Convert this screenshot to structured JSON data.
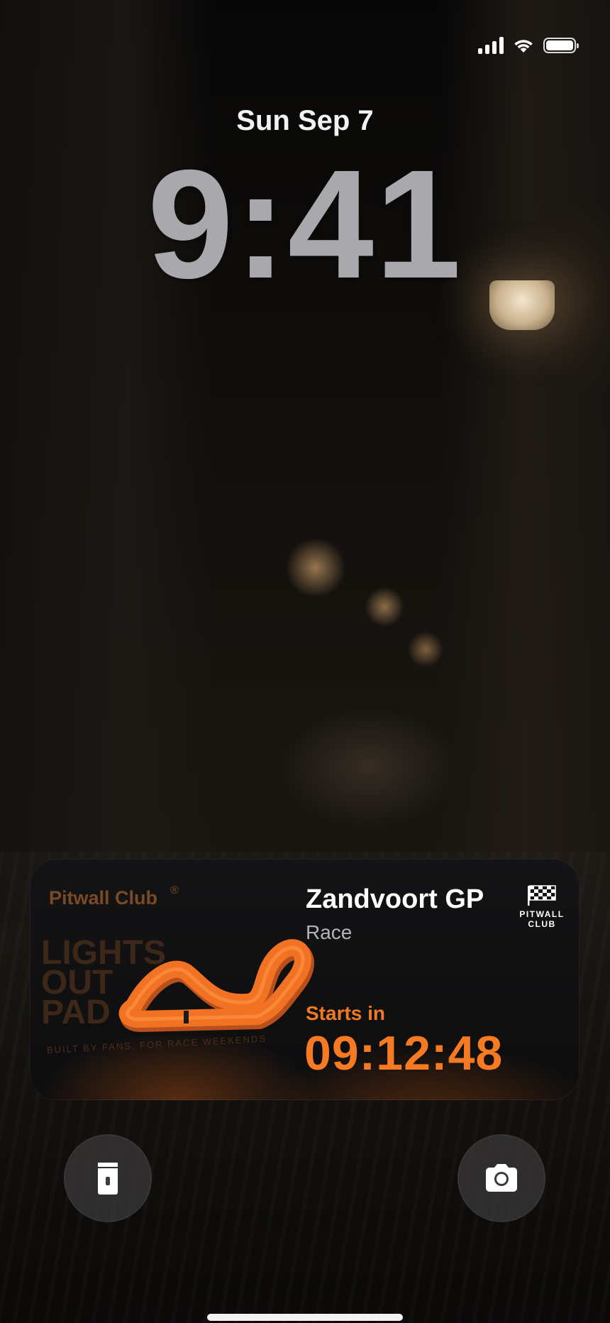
{
  "status_bar": {
    "signal_icon": "cellular-signal-icon",
    "wifi_icon": "wifi-icon",
    "battery_icon": "battery-full-icon",
    "battery_level": 1.0
  },
  "lock_screen": {
    "date": "Sun Sep 7",
    "time": "9:41"
  },
  "widget": {
    "brand": "Pitwall Club",
    "registered_mark": "®",
    "poster_lines": [
      "LIGHTS",
      "OUT",
      "PAD"
    ],
    "poster_tagline": "BUILT BY FANS, FOR RACE WEEKENDS",
    "race_name": "Zandvoort GP",
    "session": "Race",
    "logo_lines": [
      "PITWALL",
      "CLUB"
    ],
    "starts_label": "Starts in",
    "countdown": "09:12:48",
    "accent_color": "#F57A22"
  },
  "quick_actions": {
    "left_icon": "flashlight-icon",
    "right_icon": "camera-icon"
  }
}
